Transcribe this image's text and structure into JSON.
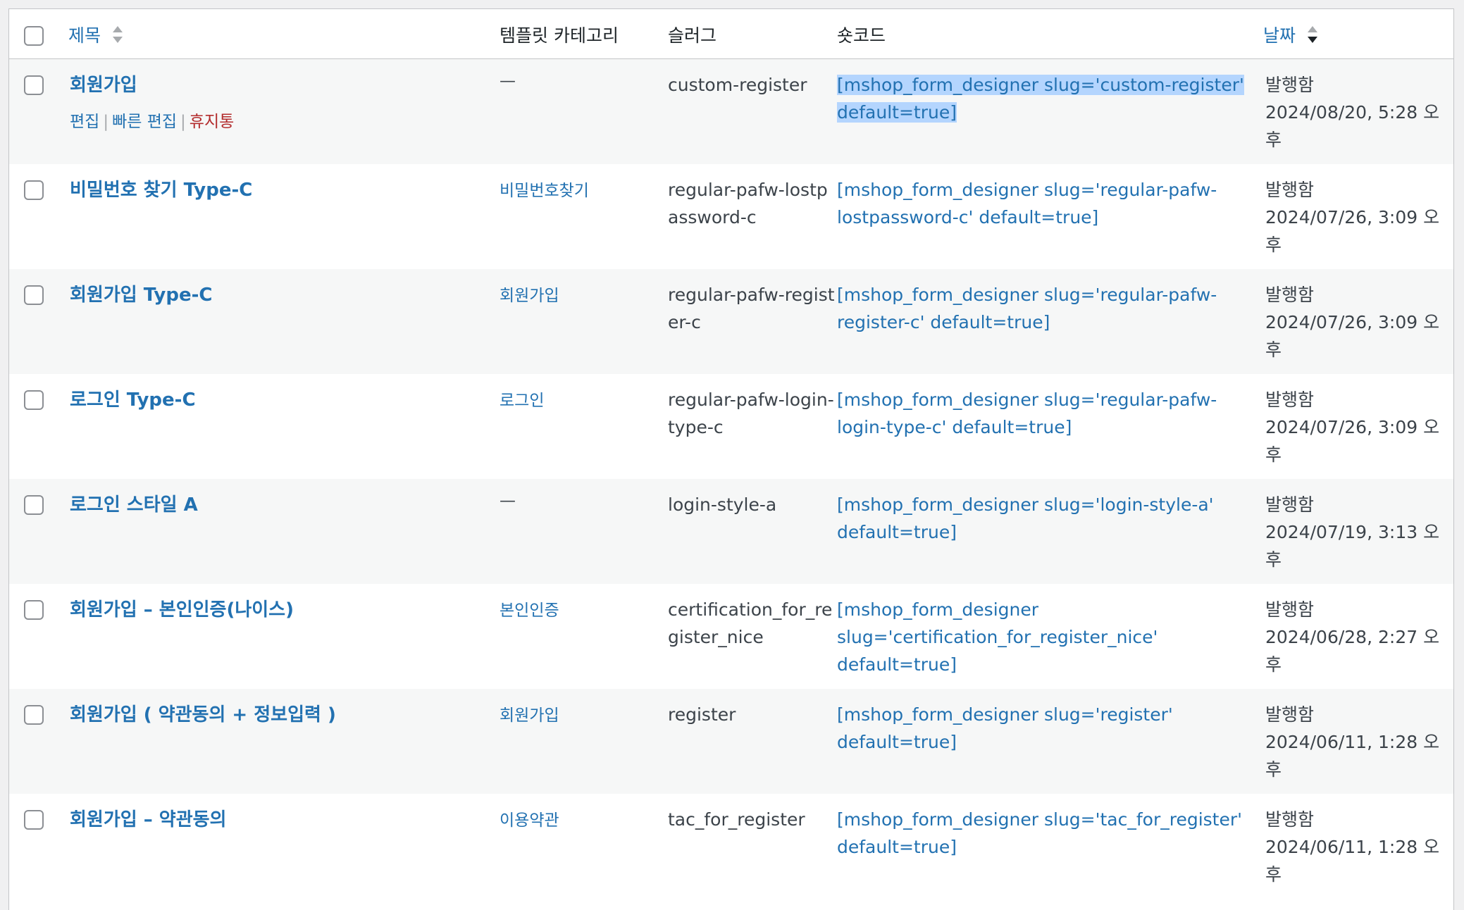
{
  "header": {
    "title": "제목",
    "category": "템플릿 카테고리",
    "slug": "슬러그",
    "shortcode": "숏코드",
    "date": "날짜"
  },
  "row_actions": {
    "edit": "편집",
    "quick_edit": "빠른 편집",
    "trash": "휴지통",
    "separator": "|"
  },
  "rows": [
    {
      "title": "회원가입",
      "category": "—",
      "slug": "custom-register",
      "shortcode": "[mshop_form_designer slug='custom-register' default=true]",
      "status": "발행함",
      "date": "2024/08/20, 5:28 오후"
    },
    {
      "title": "비밀번호 찾기 Type-C",
      "category": "비밀번호찾기",
      "slug": "regular-pafw-lostpassword-c",
      "shortcode": "[mshop_form_designer slug='regular-pafw-lostpassword-c' default=true]",
      "status": "발행함",
      "date": "2024/07/26, 3:09 오후"
    },
    {
      "title": "회원가입 Type-C",
      "category": "회원가입",
      "slug": "regular-pafw-register-c",
      "shortcode": "[mshop_form_designer slug='regular-pafw-register-c' default=true]",
      "status": "발행함",
      "date": "2024/07/26, 3:09 오후"
    },
    {
      "title": "로그인 Type-C",
      "category": "로그인",
      "slug": "regular-pafw-login-type-c",
      "shortcode": "[mshop_form_designer slug='regular-pafw-login-type-c' default=true]",
      "status": "발행함",
      "date": "2024/07/26, 3:09 오후"
    },
    {
      "title": "로그인 스타일 A",
      "category": "—",
      "slug": "login-style-a",
      "shortcode": "[mshop_form_designer slug='login-style-a' default=true]",
      "status": "발행함",
      "date": "2024/07/19, 3:13 오후"
    },
    {
      "title": "회원가입 – 본인인증(나이스)",
      "category": "본인인증",
      "slug": "certification_for_register_nice",
      "shortcode": "[mshop_form_designer slug='certification_for_register_nice' default=true]",
      "status": "발행함",
      "date": "2024/06/28, 2:27 오후"
    },
    {
      "title": "회원가입 ( 약관동의 + 정보입력 )",
      "category": "회원가입",
      "slug": "register",
      "shortcode": "[mshop_form_designer slug='register' default=true]",
      "status": "발행함",
      "date": "2024/06/11, 1:28 오후"
    },
    {
      "title": "회원가입 – 약관동의",
      "category": "이용약관",
      "slug": "tac_for_register",
      "shortcode": "[mshop_form_designer slug='tac_for_register' default=true]",
      "status": "발행함",
      "date": "2024/06/11, 1:28 오후"
    }
  ],
  "colors": {
    "link": "#2271b1",
    "trash": "#b32d2e",
    "alt_row": "#f6f7f7",
    "selection": "#b4d5fe"
  }
}
